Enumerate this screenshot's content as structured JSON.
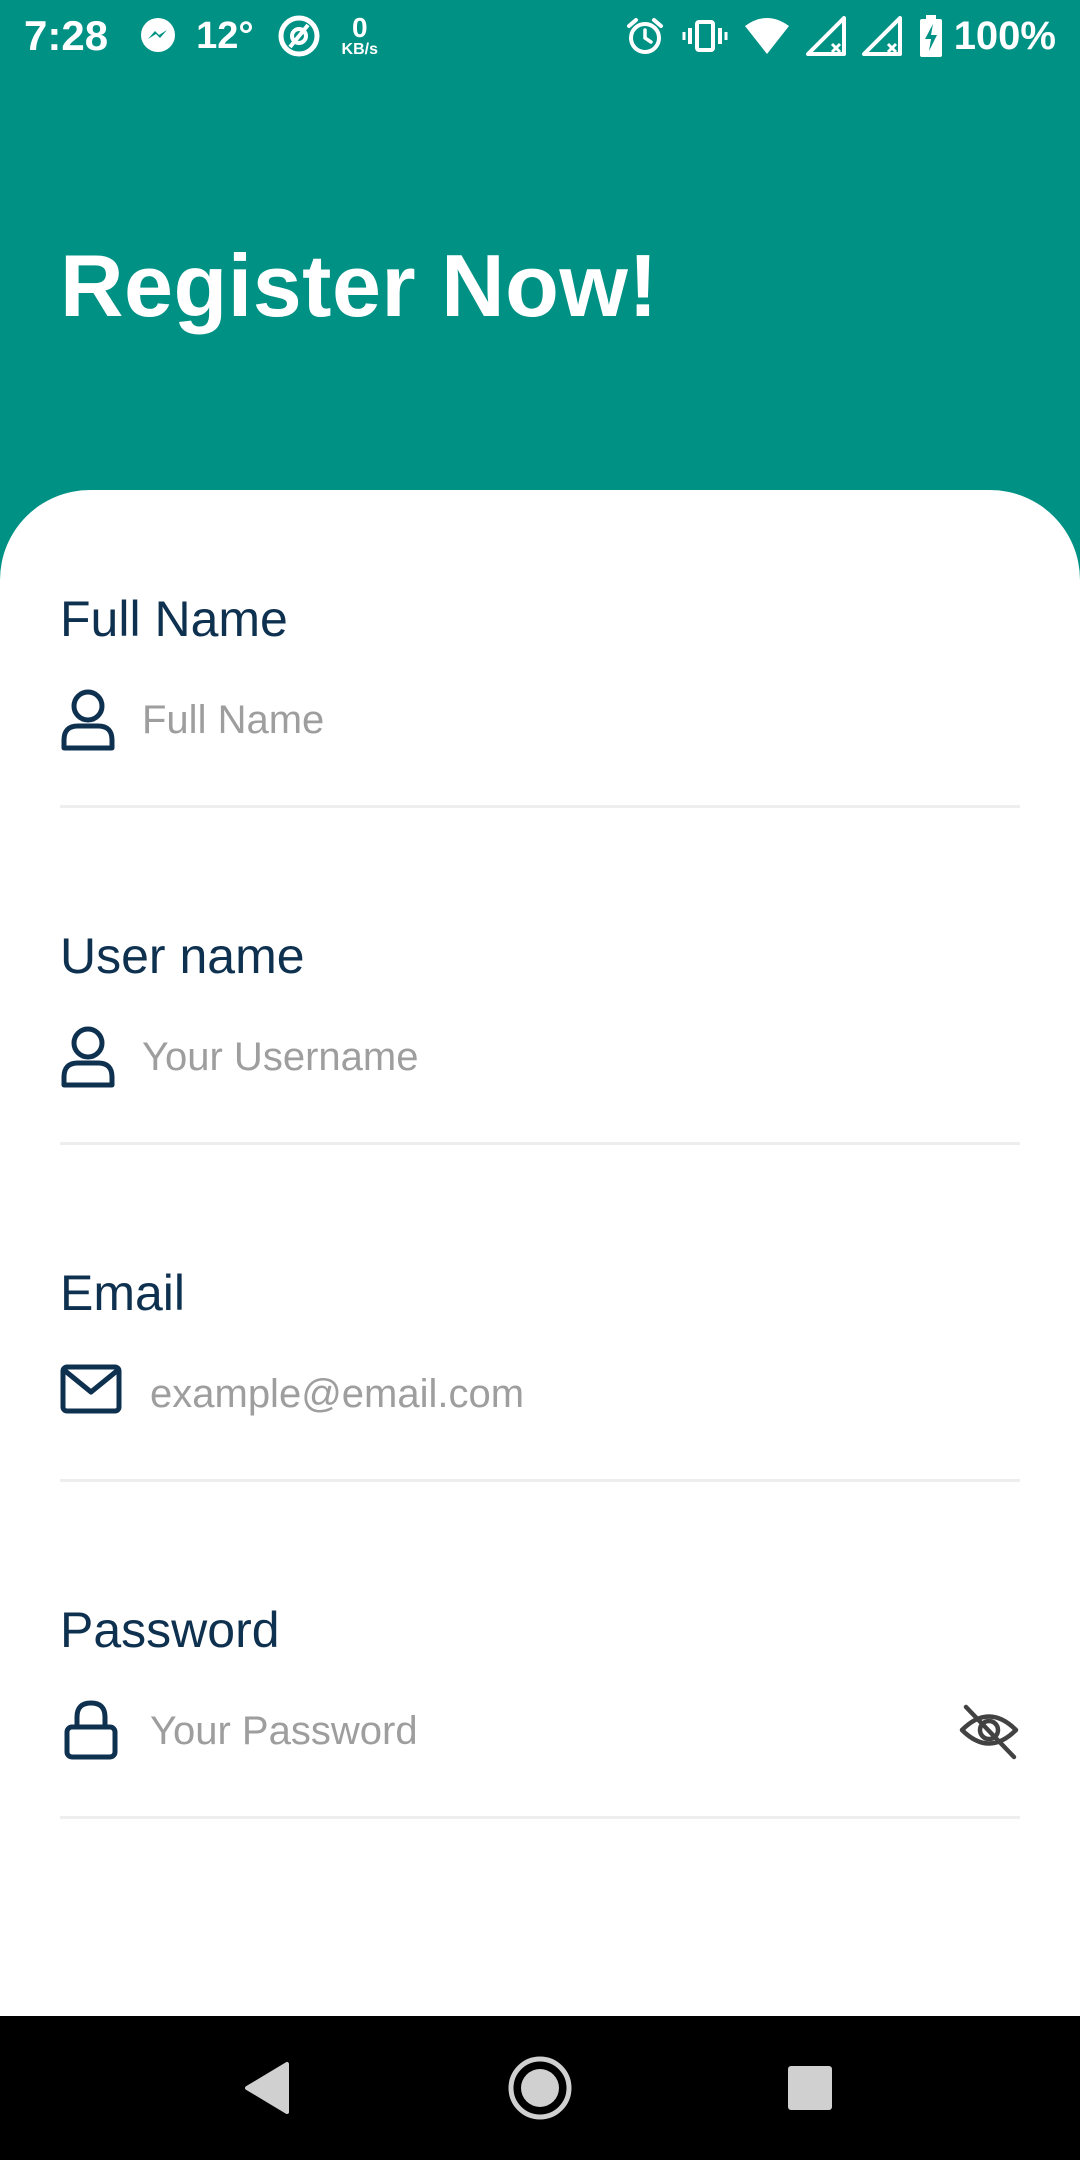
{
  "status_bar": {
    "time": "7:28",
    "temperature": "12°",
    "net_speed_value": "0",
    "net_speed_unit": "KB/s",
    "battery": "100%",
    "icons": [
      "messenger-icon",
      "data-saver-icon",
      "alarm-icon",
      "vibrate-icon",
      "wifi-icon",
      "signal-icon",
      "signal-icon",
      "battery-charging-icon"
    ]
  },
  "header": {
    "title": "Register Now!"
  },
  "form": {
    "full_name": {
      "label": "Full Name",
      "placeholder": "Full Name",
      "icon": "user-icon"
    },
    "username": {
      "label": "User name",
      "placeholder": "Your Username",
      "icon": "user-icon"
    },
    "email": {
      "label": "Email",
      "placeholder": "example@email.com",
      "icon": "mail-icon"
    },
    "password": {
      "label": "Password",
      "placeholder": "Your Password",
      "icon": "lock-icon",
      "toggle_icon": "eye-off-icon"
    }
  },
  "nav_bar": {
    "buttons": [
      "back-icon",
      "home-icon",
      "recents-icon"
    ]
  },
  "colors": {
    "brand": "#009185",
    "label": "#0f3150",
    "placeholder": "#9e9e9e",
    "divider": "#eeeeee"
  }
}
